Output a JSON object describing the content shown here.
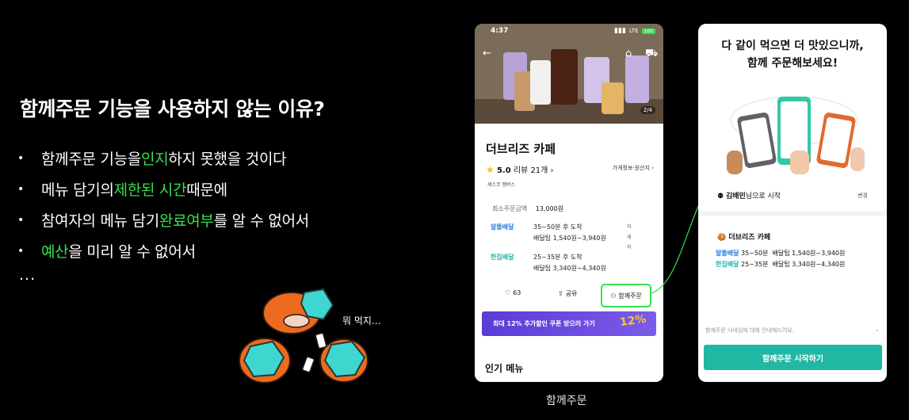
{
  "slide": {
    "title": "함께주문 기능을 사용하지 않는 이유?",
    "bullets": [
      {
        "before": "함께주문 기능을 ",
        "highlight": "인지",
        "after": "하지 못했을 것이다"
      },
      {
        "before": "메뉴 담기의 ",
        "highlight": "제한된 시간",
        "after": " 때문에"
      },
      {
        "before": "참여자의 메뉴 담기 ",
        "highlight": "완료여부",
        "after": "를 알 수 없어서"
      },
      {
        "before": "",
        "highlight": "예산",
        "after": "을 미리 알 수 없어서"
      }
    ],
    "ellipsis": "...",
    "mascot_caption": "뭐 먹지...",
    "highlight_color": "#37e04f"
  },
  "phone1": {
    "caption": "함께주문",
    "status": {
      "time": "4:37",
      "network": "LTE",
      "battery": "100"
    },
    "image_counter": "2/4",
    "store_name": "더브리즈 카페",
    "rating": "5.0",
    "review": "리뷰 21개",
    "store_info": "가게정보·원산지",
    "sub_label": "세스코 멤버스",
    "min_order_label": "최소주문금액",
    "min_order_value": "13,000원",
    "delivery": [
      {
        "brand": "알뜰배달",
        "time": "35~50분 후 도착",
        "tip": "배달팁 1,540원~3,940원",
        "detail": "자세히"
      },
      {
        "brand": "한집배달",
        "time": "25~35분 후 도착",
        "tip": "배달팁 3,340원~4,340원",
        "detail": ""
      }
    ],
    "actions": {
      "likes": "63",
      "share": "공유",
      "group": "함께주문"
    },
    "coupon": "최대 12% 추가할인 쿠폰 받으러 가기",
    "coupon_badge": "12%",
    "popular": "인기 메뉴"
  },
  "phone2": {
    "heading_line1": "다 같이 먹으면 더 맛있으니까,",
    "heading_line2": "함께 주문해보세요!",
    "user_name": "김배민",
    "user_suffix": "님으로 시작",
    "change": "변경",
    "store_name": "더브리즈 카페",
    "rows": [
      {
        "brand": "알뜰배달",
        "time": "35~50분",
        "tip": "배달팁 1,540원~3,940원"
      },
      {
        "brand": "한집배달",
        "time": "25~35분",
        "tip": "배달팁 3,340원~4,340원"
      }
    ],
    "notice": "함께주문 닉네임에 대해 안내해드려요.",
    "start_button": "함께주문 시작하기",
    "accent": "#22b7a3"
  }
}
